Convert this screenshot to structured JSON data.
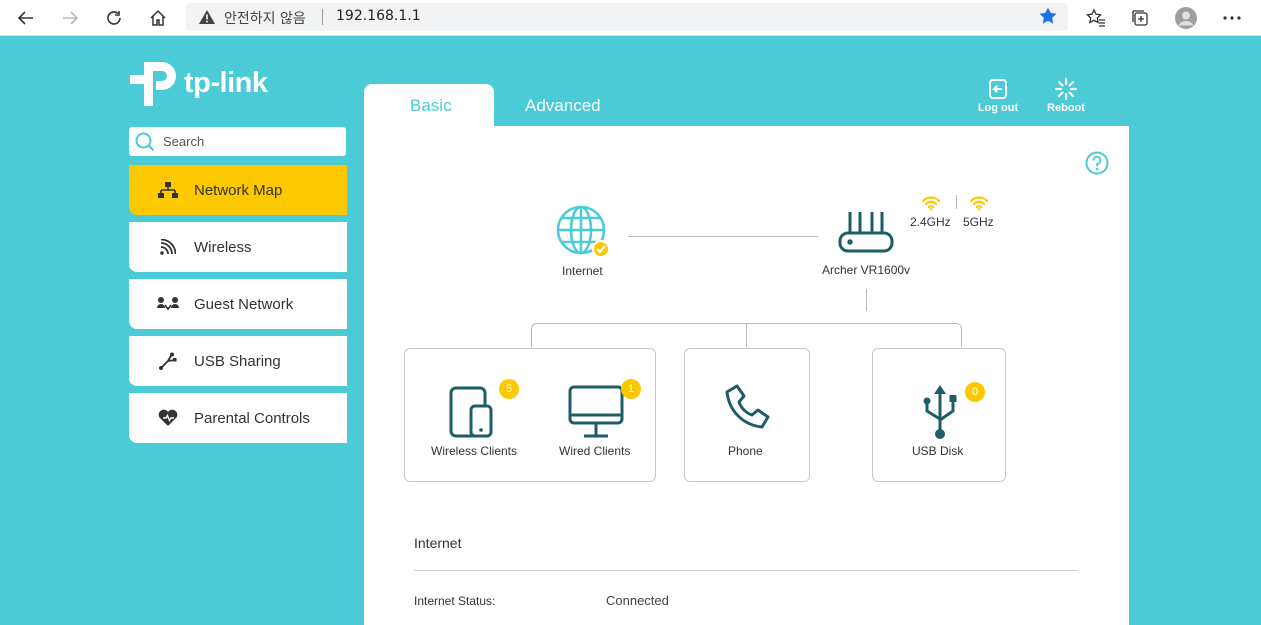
{
  "browser": {
    "security_warning": "안전하지 않음",
    "url": "192.168.1.1"
  },
  "brand": {
    "logo_text": "tp-link"
  },
  "sidebar": {
    "search_placeholder": "Search",
    "items": [
      {
        "label": "Network Map",
        "icon": "network-map-icon",
        "active": true
      },
      {
        "label": "Wireless",
        "icon": "wireless-icon",
        "active": false
      },
      {
        "label": "Guest Network",
        "icon": "guest-network-icon",
        "active": false
      },
      {
        "label": "USB Sharing",
        "icon": "usb-sharing-icon",
        "active": false
      },
      {
        "label": "Parental Controls",
        "icon": "parental-controls-icon",
        "active": false
      }
    ]
  },
  "tabs": [
    {
      "label": "Basic",
      "active": true
    },
    {
      "label": "Advanced",
      "active": false
    }
  ],
  "actions": {
    "logout_label": "Log out",
    "reboot_label": "Reboot"
  },
  "network_map": {
    "internet_label": "Internet",
    "router_label": "Archer VR1600v",
    "band_24": "2.4GHz",
    "band_5": "5GHz",
    "wireless_clients": {
      "label": "Wireless Clients",
      "count": "5"
    },
    "wired_clients": {
      "label": "Wired Clients",
      "count": "1"
    },
    "phone": {
      "label": "Phone"
    },
    "usb_disk": {
      "label": "USB Disk",
      "count": "0"
    }
  },
  "internet_section": {
    "title": "Internet",
    "status_key": "Internet Status:",
    "status_value": "Connected"
  },
  "colors": {
    "accent": "#4acbd6",
    "active": "#fcc900",
    "icon_dark": "#1e5d66"
  }
}
